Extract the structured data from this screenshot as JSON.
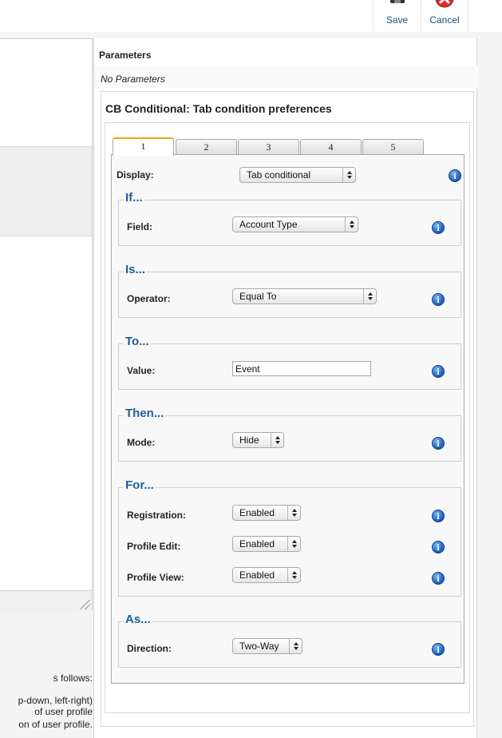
{
  "toolbar": {
    "save_label": "Save",
    "cancel_label": "Cancel",
    "save_icon": "floppy-disk-icon",
    "cancel_icon": "red-x-circle-icon"
  },
  "left": {
    "line1": "s follows:",
    "line2": "p-down, left-right)",
    "line3": "of user profile",
    "line4": "on of user profile."
  },
  "parameters": {
    "title": "Parameters",
    "empty": "No Parameters"
  },
  "cb": {
    "title": "CB Conditional: Tab condition preferences",
    "tabs": [
      "1",
      "2",
      "3",
      "4",
      "5"
    ],
    "display": {
      "label": "Display:",
      "value": "Tab conditional"
    },
    "if": {
      "legend": "If...",
      "field": {
        "label": "Field:",
        "value": "Account Type"
      }
    },
    "is": {
      "legend": "Is...",
      "operator": {
        "label": "Operator:",
        "value": "Equal To"
      }
    },
    "to": {
      "legend": "To...",
      "value": {
        "label": "Value:",
        "value": "Event"
      }
    },
    "then": {
      "legend": "Then...",
      "mode": {
        "label": "Mode:",
        "value": "Hide"
      }
    },
    "for": {
      "legend": "For...",
      "registration": {
        "label": "Registration:",
        "value": "Enabled"
      },
      "profile_edit": {
        "label": "Profile Edit:",
        "value": "Enabled"
      },
      "profile_view": {
        "label": "Profile View:",
        "value": "Enabled"
      }
    },
    "as": {
      "legend": "As...",
      "direction": {
        "label": "Direction:",
        "value": "Two-Way"
      }
    }
  },
  "colors": {
    "legend": "#1f5d9a",
    "active_tab_accent": "#f2a416",
    "info_icon": "#1e62c4"
  }
}
